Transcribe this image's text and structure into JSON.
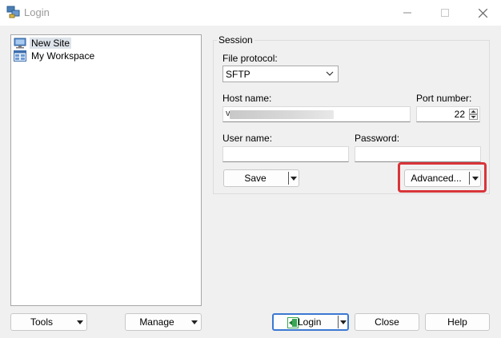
{
  "window": {
    "title": "Login"
  },
  "colors": {
    "highlight": "#d9343a",
    "focus_border": "#3b78d2",
    "login_icon": "#3aa655"
  },
  "site_tree": {
    "items": [
      {
        "label": "New Site",
        "icon": "monitor-icon",
        "selected": true
      },
      {
        "label": "My Workspace",
        "icon": "workspace-icon",
        "selected": false
      }
    ]
  },
  "session": {
    "title": "Session",
    "file_protocol_label": "File protocol:",
    "file_protocol_value": "SFTP",
    "host_name_label": "Host name:",
    "host_name_visible": "v",
    "port_label": "Port number:",
    "port_value": "22",
    "user_name_label": "User name:",
    "user_name_value": "",
    "password_label": "Password:",
    "password_value": "",
    "save_label": "Save",
    "advanced_label": "Advanced..."
  },
  "bottom": {
    "tools_label": "Tools",
    "manage_label": "Manage",
    "login_label": "Login",
    "close_label": "Close",
    "help_label": "Help"
  }
}
